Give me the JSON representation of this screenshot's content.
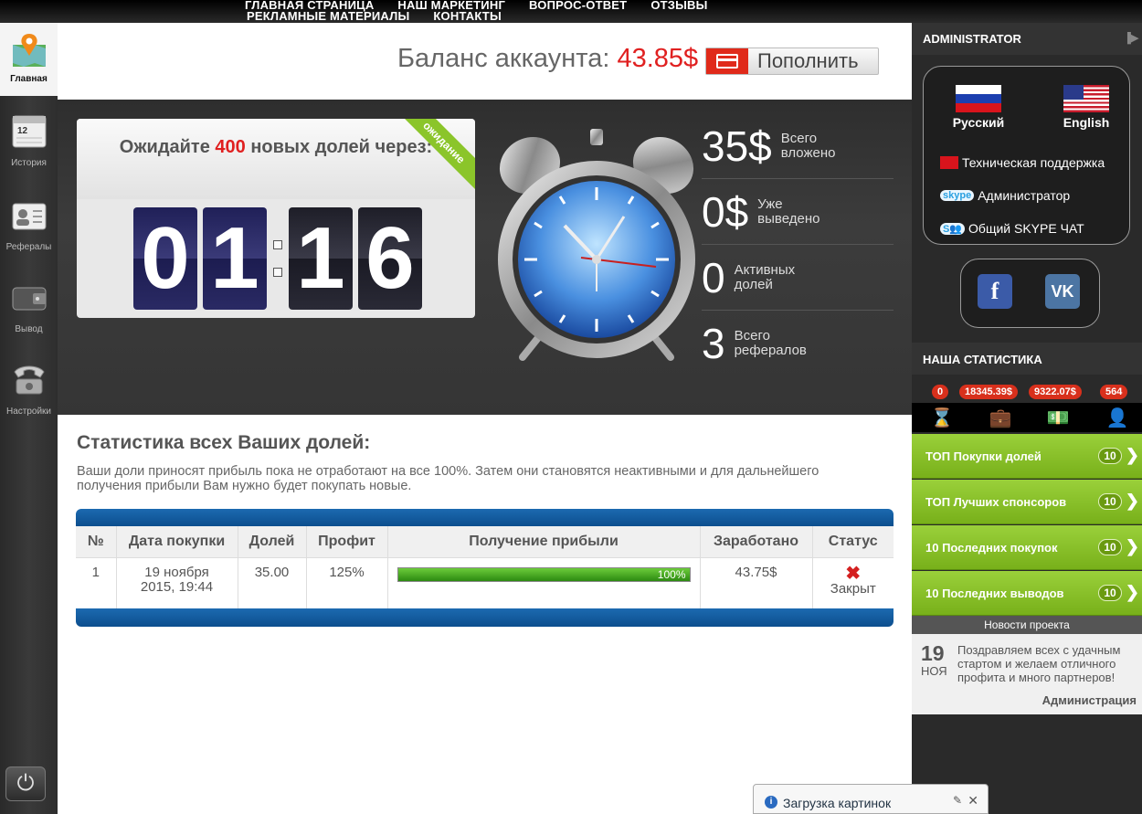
{
  "nav": {
    "row1": [
      "ГЛАВНАЯ СТРАНИЦА",
      "НАШ МАРКЕТИНГ",
      "ВОПРОС-ОТВЕТ",
      "ОТЗЫВЫ"
    ],
    "row2": [
      "РЕКЛАМНЫЕ МАТЕРИАЛЫ",
      "КОНТАКТЫ"
    ]
  },
  "sidebar": {
    "items": [
      {
        "label": "Главная",
        "icon": "map-pin-icon"
      },
      {
        "label": "История",
        "icon": "calendar-icon"
      },
      {
        "label": "Рефералы",
        "icon": "contacts-icon"
      },
      {
        "label": "Вывод",
        "icon": "wallet-icon"
      },
      {
        "label": "Настройки",
        "icon": "phone-icon"
      }
    ],
    "power_icon": "power-icon"
  },
  "balance": {
    "label": "Баланс аккаунта: ",
    "value": "43.85$",
    "topup_label": "Пополнить"
  },
  "countdown": {
    "prefix": "Ожидайте ",
    "count": "400",
    "suffix": " новых долей через:",
    "ribbon": "ожидание",
    "digits": [
      "0",
      "1",
      "1",
      "6"
    ]
  },
  "stats": [
    {
      "number": "35$",
      "label": "Всего вложено"
    },
    {
      "number": "0$",
      "label": "Уже выведено"
    },
    {
      "number": "0",
      "label": "Активных долей"
    },
    {
      "number": "3",
      "label": "Всего рефералов"
    }
  ],
  "section": {
    "title": "Статистика всех Ваших долей:",
    "desc": "Ваши доли приносят прибыль пока не отработают на все 100%. Затем они становятся неактивными и для дальнейшего получения прибыли Вам нужно будет покупать новые."
  },
  "table": {
    "headers": [
      "№",
      "Дата покупки",
      "Долей",
      "Профит",
      "Получение прибыли",
      "Заработано",
      "Статус"
    ],
    "rows": [
      {
        "num": "1",
        "date": "19 ноября 2015, 19:44",
        "shares": "35.00",
        "profit": "125%",
        "progress_label": "100%",
        "progress": 1.0,
        "earned": "43.75$",
        "status": "Закрыт"
      }
    ]
  },
  "right": {
    "admin_title": "ADMINISTRATOR",
    "languages": [
      "Русский",
      "English"
    ],
    "links": [
      "Техническая поддержка",
      "Администратор",
      "Общий SKYPE ЧАТ"
    ],
    "skype_word": "skype",
    "stat_title": "НАША СТАТИСТИКА",
    "badges": [
      "0",
      "18345.39$",
      "9322.07$",
      "564"
    ],
    "green_items": [
      {
        "label": "ТОП Покупки долей",
        "count": "10"
      },
      {
        "label": "ТОП Лучших спонсоров",
        "count": "10"
      },
      {
        "label": "10 Последних покупок",
        "count": "10"
      },
      {
        "label": "10 Последних выводов",
        "count": "10"
      }
    ],
    "news_title": "Новости проекта",
    "news": {
      "day": "19",
      "month": "НОЯ",
      "text": "Поздравляем всех с удачным стартом и желаем отличного профита и много партнеров!",
      "signature": "Администрация"
    }
  },
  "loader": {
    "text": "Загрузка картинок"
  },
  "colors": {
    "accent_red": "#e02020",
    "green": "#8bc52a",
    "table_blue": "#0c4e8e"
  }
}
